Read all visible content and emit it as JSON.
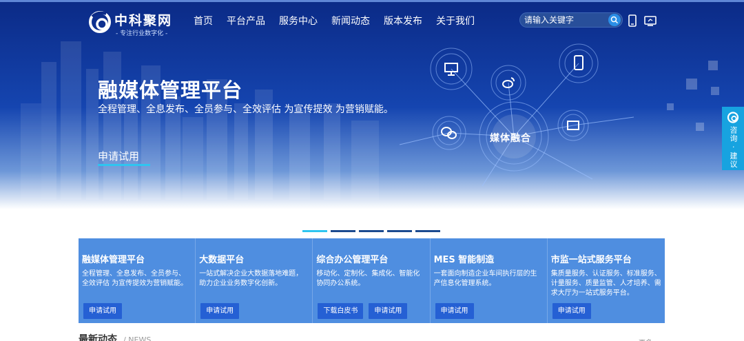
{
  "header": {
    "logo_name": "中科聚网",
    "logo_slogan": "- 专注行业数字化 -",
    "nav": [
      "首页",
      "平台产品",
      "服务中心",
      "新闻动态",
      "版本发布",
      "关于我们"
    ],
    "search_placeholder": "请输入关键字",
    "icons": [
      "search-icon",
      "mobile-icon",
      "desktop-icon"
    ]
  },
  "hero": {
    "title": "融媒体管理平台",
    "subtitle": "全程管理、全息发布、全员参与、全效评估 为宣传提效 为营销赋能。",
    "cta": "申请试用",
    "diagram_center": "媒体融合",
    "diagram_nodes": [
      "monitor-icon",
      "weibo-icon",
      "mobile-icon",
      "baidu-icon",
      "wechat-icon"
    ]
  },
  "side_float": {
    "text": "咨询 · 建议"
  },
  "slider": {
    "count": 5,
    "active": 0
  },
  "cards": [
    {
      "title": "融媒体管理平台",
      "desc": "全程管理、全息发布、全员参与、全效评估 为宣传提效为营销赋能。",
      "buttons": [
        "申请试用"
      ]
    },
    {
      "title": "大数据平台",
      "desc": "一站式解决企业大数据落地难题，助力企业业务数字化创新。",
      "buttons": [
        "申请试用"
      ]
    },
    {
      "title": "综合办公管理平台",
      "desc": "移动化、定制化、集成化、智能化协同办公系统。",
      "buttons": [
        "下载白皮书",
        "申请试用"
      ]
    },
    {
      "title": "MES 智能制造",
      "desc": "一套面向制造企业车间执行层的生产信息化管理系统。",
      "buttons": [
        "申请试用"
      ]
    },
    {
      "title": "市监一站式服务平台",
      "desc": "集质量服务、认证服务、标准服务、计量服务、质量监管、人才培养、需求大厅为一站式服务平台。",
      "buttons": [
        "申请试用"
      ]
    }
  ],
  "news": {
    "title": "最新动态",
    "title_en": "/ NEWS",
    "more": "更多"
  },
  "colors": {
    "accent": "#2ec5f0",
    "card_bg": "#4f8ee0",
    "button": "#2560d4",
    "hero_dark": "#0b2a86"
  }
}
